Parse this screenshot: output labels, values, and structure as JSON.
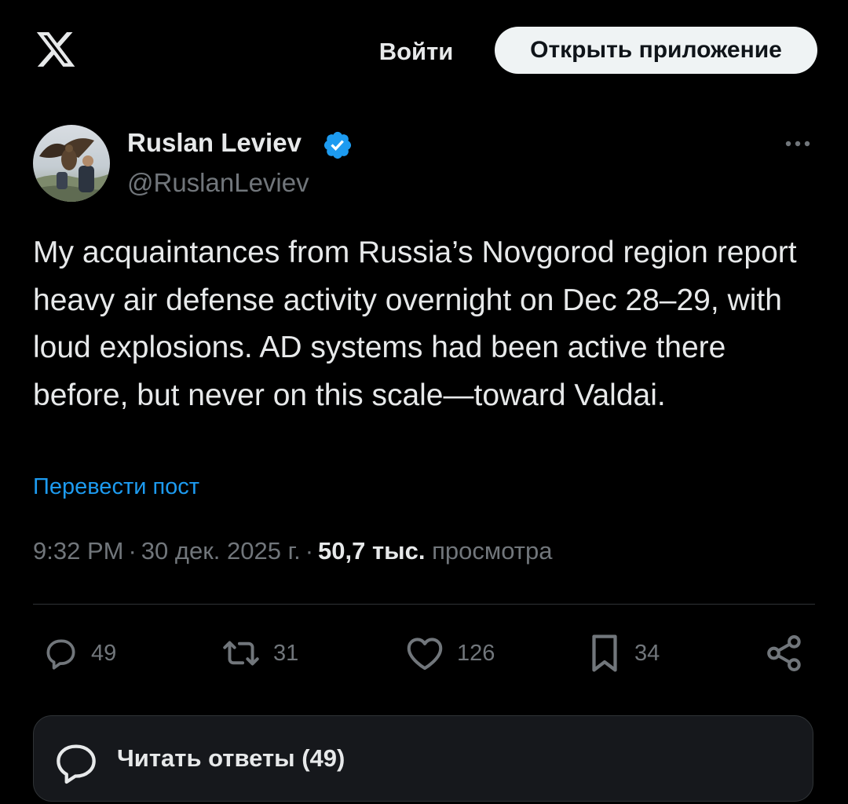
{
  "header": {
    "logo_icon": "x-logo-icon",
    "login_label": "Войти",
    "open_app_label": "Открыть приложение"
  },
  "author": {
    "name": "Ruslan Leviev",
    "handle": "@RuslanLeviev",
    "verified": true,
    "verified_color": "#1d9bf0"
  },
  "tweet": {
    "text": "My acquaintances from Russia’s Novgorod region report heavy air defense activity overnight on Dec 28–29, with loud explosions. AD systems had been active there before, but never on this scale—toward Valdai.",
    "translate_label": "Перевести пост",
    "time": "9:32 PM",
    "date": "30 дек. 2025 г.",
    "views_count": "50,7 тыс.",
    "views_label": "просмотра"
  },
  "actions": {
    "replies": "49",
    "reposts": "31",
    "likes": "126",
    "bookmarks": "34"
  },
  "read_replies": {
    "label": "Читать ответы (49)"
  },
  "colors": {
    "background": "#000000",
    "text_primary": "#e7e9ea",
    "text_secondary": "#71767b",
    "accent": "#1d9bf0",
    "divider": "#2f3336"
  }
}
